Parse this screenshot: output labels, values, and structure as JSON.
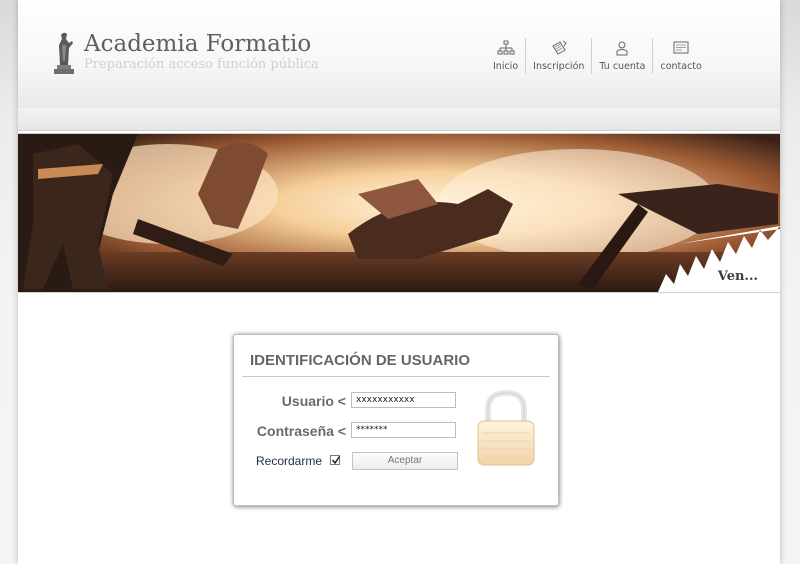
{
  "site": {
    "title": "Academia Formatio",
    "subtitle": "Preparación acceso función pública",
    "logo_icon": "classical-statue-icon"
  },
  "nav": [
    {
      "label": "Inicio",
      "icon": "sitemap-icon"
    },
    {
      "label": "Inscripción",
      "icon": "pencil-note-icon"
    },
    {
      "label": "Tu cuenta",
      "icon": "user-icon"
    },
    {
      "label": "contacto",
      "icon": "message-icon"
    }
  ],
  "banner": {
    "caption": "Ven...",
    "image": "fire-rescue-scene"
  },
  "login": {
    "title": "IDENTIFICACIÓN DE USUARIO",
    "user_label": "Usuario <",
    "user_value": "xxxxxxxxxxx",
    "password_label": "Contraseña <",
    "password_value": "*******",
    "remember_label": "Recordarme",
    "remember_checked": true,
    "submit_label": "Aceptar",
    "lock_icon": "padlock-icon"
  },
  "colors": {
    "label_gray": "#6a6a6a",
    "remember_text": "#1e2b52",
    "banner_fire": "#f3c58a"
  }
}
